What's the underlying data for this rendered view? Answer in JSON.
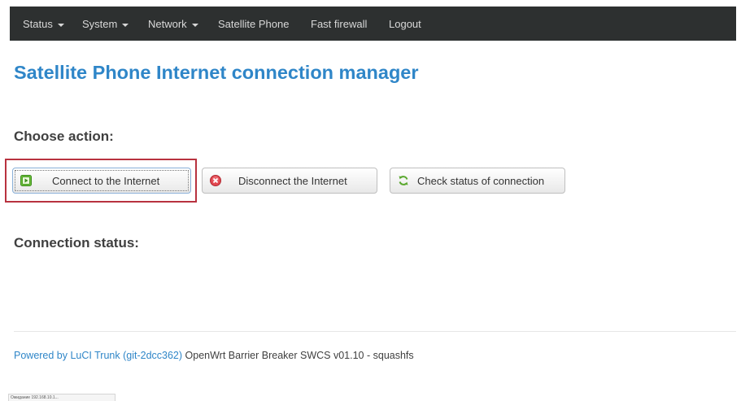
{
  "nav": {
    "status": "Status",
    "system": "System",
    "network": "Network",
    "satellite_phone": "Satellite Phone",
    "fast_firewall": "Fast firewall",
    "logout": "Logout"
  },
  "page_title": "Satellite Phone Internet connection manager",
  "choose_action": "Choose action:",
  "actions": {
    "connect": "Connect to the Internet",
    "disconnect": "Disconnect the Internet",
    "check_status": "Check status of connection"
  },
  "connection_status_heading": "Connection status:",
  "footer": {
    "link_text": "Powered by LuCI Trunk (git-2dcc362)",
    "version_text": " OpenWrt Barrier Breaker SWCS v01.10 - squashfs"
  },
  "browser_status": "Ожидание 192.168.10.1...",
  "colors": {
    "navbar_bg": "#2d3030",
    "title_blue": "#2f86c8",
    "highlight_red": "#b8323f"
  },
  "icons": {
    "connect": "play-green-icon",
    "disconnect": "close-red-icon",
    "check_status": "refresh-green-icon"
  }
}
